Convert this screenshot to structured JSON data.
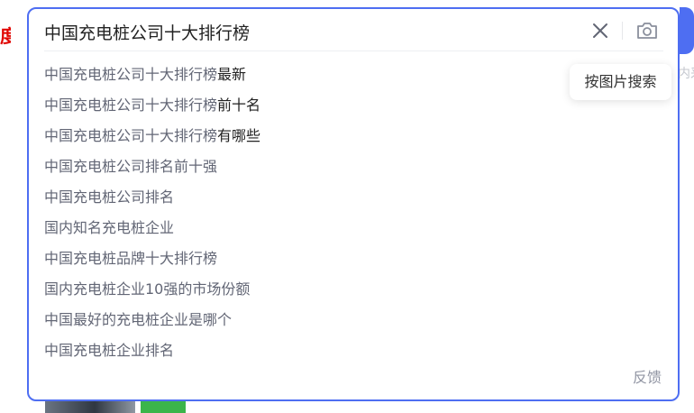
{
  "brand": {
    "fragment_text": "度"
  },
  "background": {
    "right_fragment_text": "内采"
  },
  "search": {
    "query": "中国充电桩公司十大排行榜",
    "clear_icon": "close-icon",
    "camera_icon": "camera-icon",
    "image_search_tooltip": "按图片搜索",
    "accent_color": "#4e6ef2"
  },
  "suggestions": [
    {
      "prefix": "中国充电桩公司十大排行榜",
      "suffix": "最新"
    },
    {
      "prefix": "中国充电桩公司十大排行榜",
      "suffix": "前十名"
    },
    {
      "prefix": "中国充电桩公司十大排行榜",
      "suffix": "有哪些"
    },
    {
      "prefix": "中国充电桩公司排名前十强",
      "suffix": ""
    },
    {
      "prefix": "中国充电桩公司排名",
      "suffix": ""
    },
    {
      "prefix": "国内知名充电桩企业",
      "suffix": ""
    },
    {
      "prefix": "中国充电桩品牌十大排行榜",
      "suffix": ""
    },
    {
      "prefix": "国内充电桩企业10强的市场份额",
      "suffix": ""
    },
    {
      "prefix": "中国最好的充电桩企业是哪个",
      "suffix": ""
    },
    {
      "prefix": "中国充电桩企业排名",
      "suffix": ""
    }
  ],
  "feedback_label": "反馈"
}
